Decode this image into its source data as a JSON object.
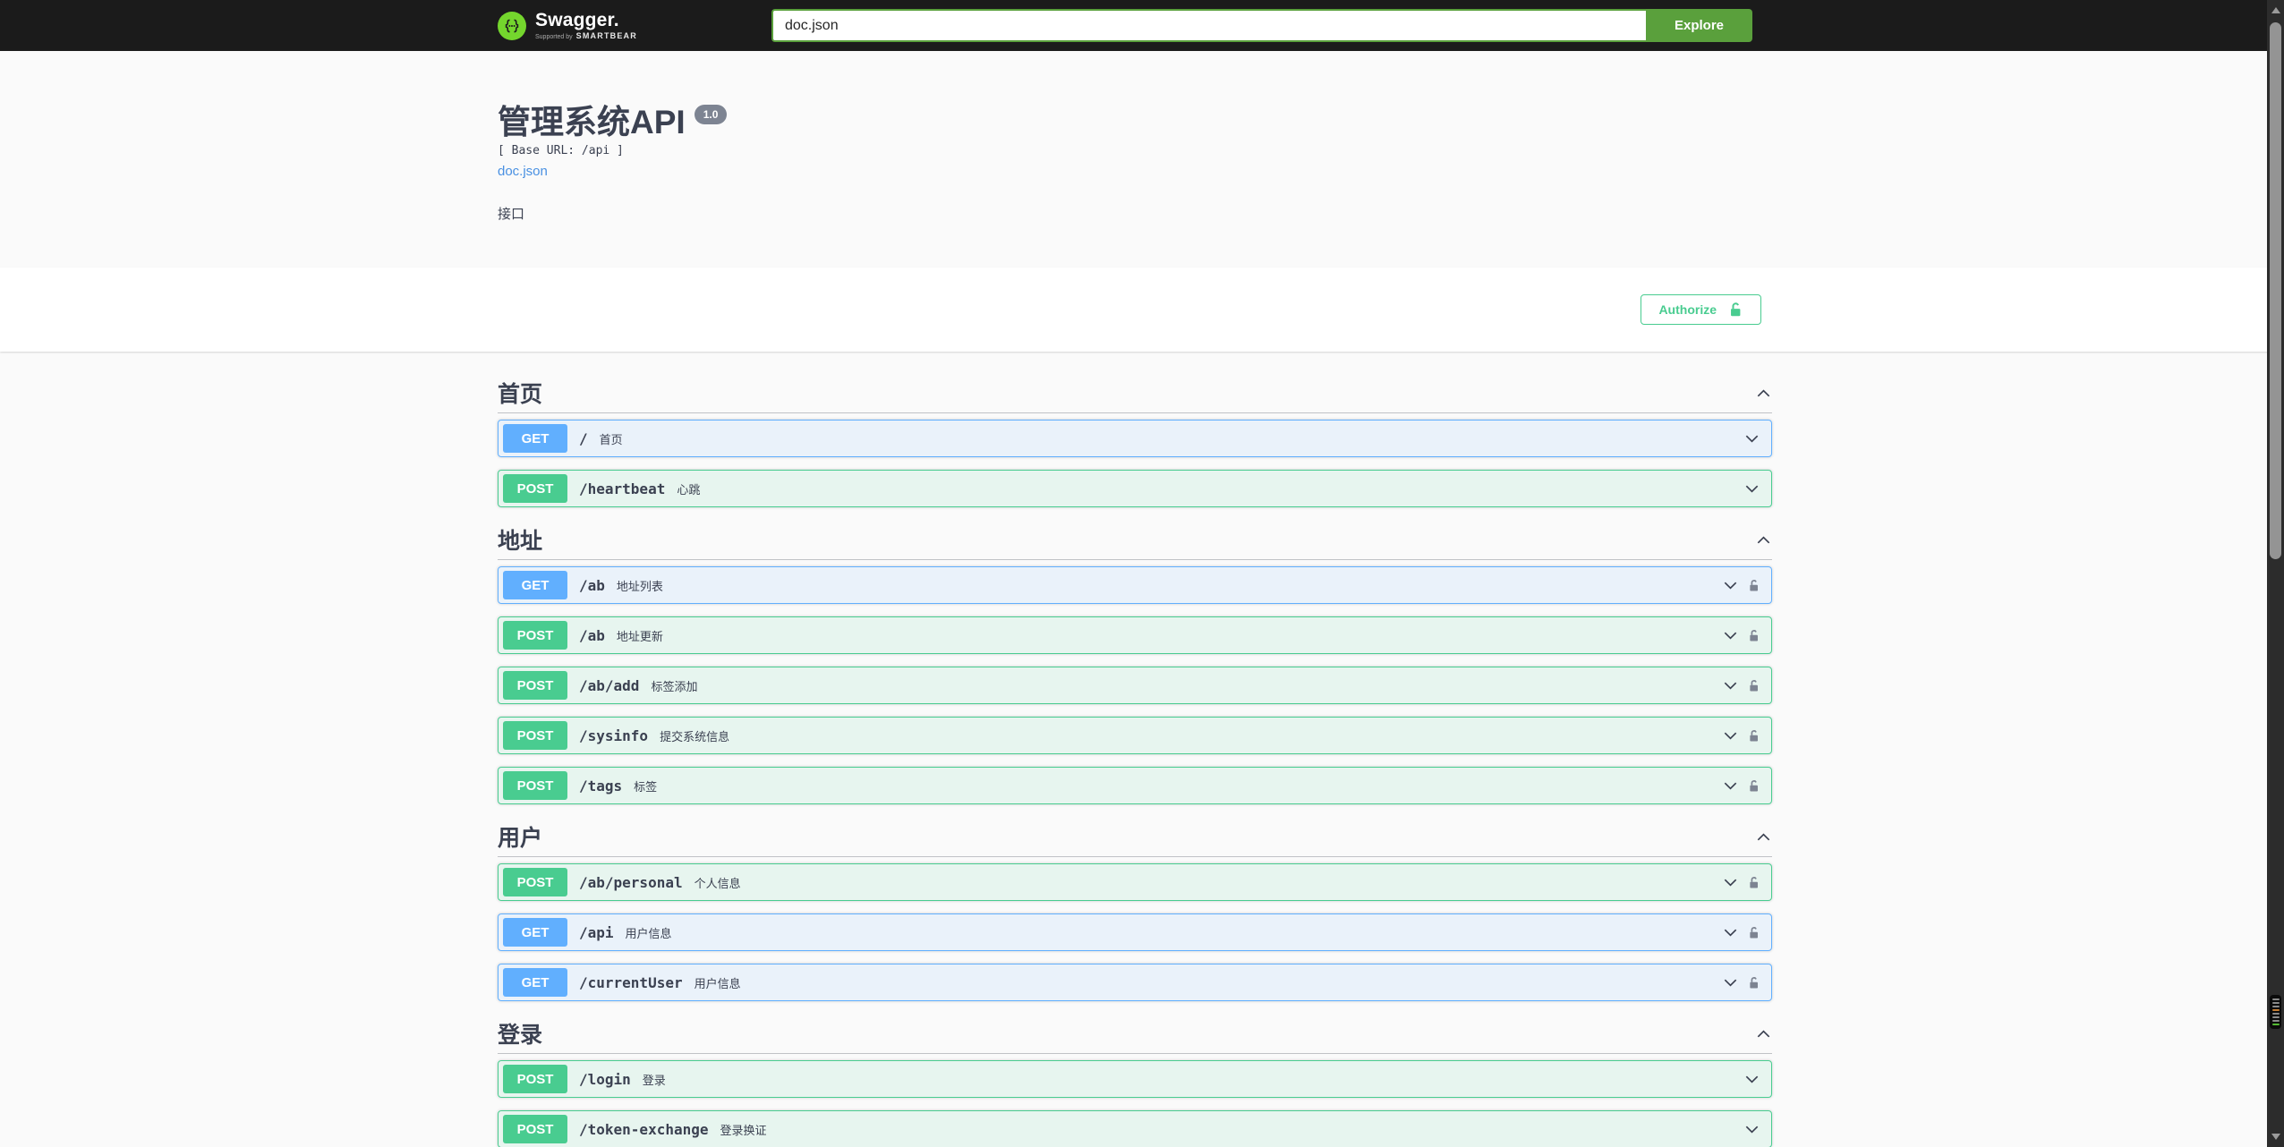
{
  "topbar": {
    "logo": {
      "name": "Swagger.",
      "tagline_prefix": "Supported by",
      "tagline_brand": "SMARTBEAR"
    },
    "search": {
      "value": "doc.json"
    },
    "explore_label": "Explore"
  },
  "info": {
    "title": "管理系统API",
    "version": "1.0",
    "base_url": "[ Base URL: /api ]",
    "spec_link": "doc.json",
    "description": "接口"
  },
  "auth": {
    "authorize_label": "Authorize"
  },
  "sections": [
    {
      "title": "首页",
      "expanded": true,
      "operations": [
        {
          "method": "GET",
          "path": "/",
          "summary": "首页",
          "locked": false
        },
        {
          "method": "POST",
          "path": "/heartbeat",
          "summary": "心跳",
          "locked": false
        }
      ]
    },
    {
      "title": "地址",
      "expanded": true,
      "operations": [
        {
          "method": "GET",
          "path": "/ab",
          "summary": "地址列表",
          "locked": true
        },
        {
          "method": "POST",
          "path": "/ab",
          "summary": "地址更新",
          "locked": true
        },
        {
          "method": "POST",
          "path": "/ab/add",
          "summary": "标签添加",
          "locked": true
        },
        {
          "method": "POST",
          "path": "/sysinfo",
          "summary": "提交系统信息",
          "locked": true
        },
        {
          "method": "POST",
          "path": "/tags",
          "summary": "标签",
          "locked": true
        }
      ]
    },
    {
      "title": "用户",
      "expanded": true,
      "operations": [
        {
          "method": "POST",
          "path": "/ab/personal",
          "summary": "个人信息",
          "locked": true
        },
        {
          "method": "GET",
          "path": "/api",
          "summary": "用户信息",
          "locked": true
        },
        {
          "method": "GET",
          "path": "/currentUser",
          "summary": "用户信息",
          "locked": true
        }
      ]
    },
    {
      "title": "登录",
      "expanded": true,
      "operations": [
        {
          "method": "POST",
          "path": "/login",
          "summary": "登录",
          "locked": false
        },
        {
          "method": "POST",
          "path": "/token-exchange",
          "summary": "登录换证",
          "locked": false
        }
      ]
    }
  ],
  "colors": {
    "topbar_bg": "#1b1b1b",
    "logo_green": "#74d62d",
    "explore_green": "#5aa03c",
    "get_blue": "#61affe",
    "post_green": "#49cc90",
    "authorize_green": "#49cc90",
    "link_blue": "#4990e2",
    "version_badge_gray": "#7d8492",
    "text_dark": "#3b4151"
  },
  "scrollbar": {
    "marker_colors": [
      "#8a8a8a",
      "#8a8a8a",
      "#8a8a8a",
      "#c77f35",
      "#8a8a8a",
      "#8a8a8a",
      "#8a8a8a",
      "#55bb33"
    ]
  }
}
